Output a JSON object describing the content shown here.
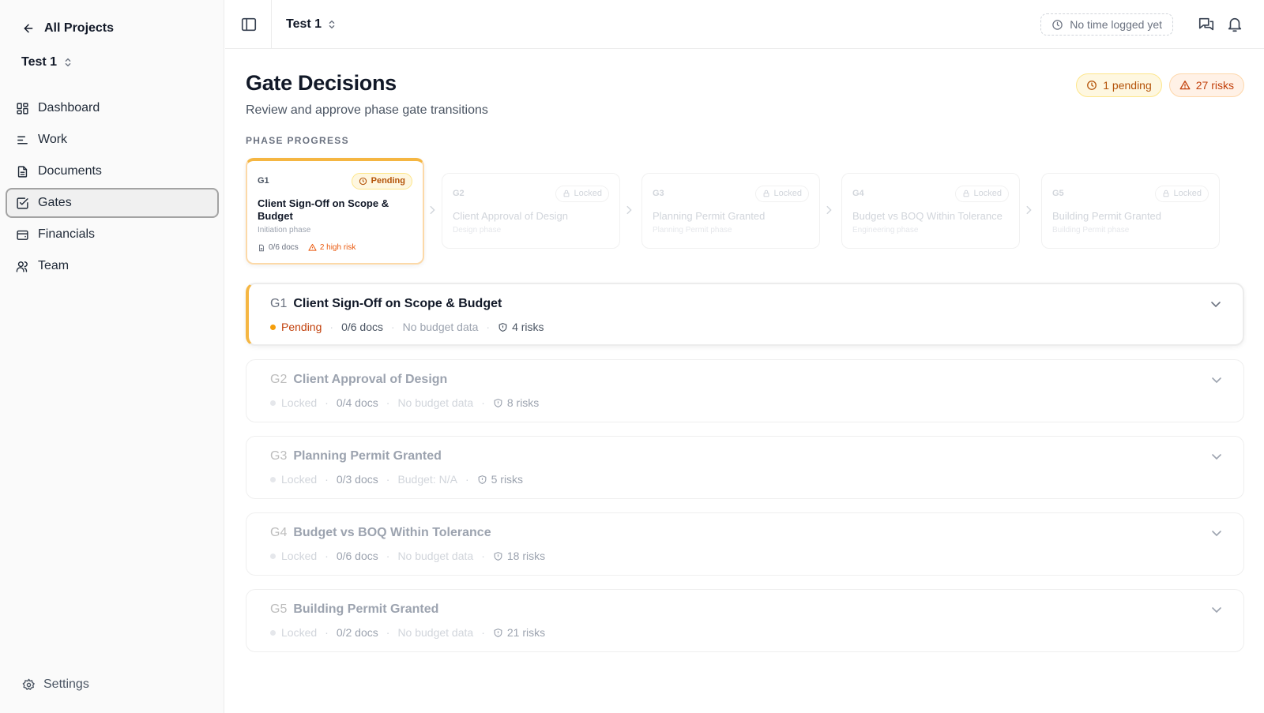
{
  "sidebar": {
    "back_label": "All Projects",
    "project_name": "Test 1",
    "nav": [
      {
        "label": "Dashboard",
        "icon": "dashboard-icon"
      },
      {
        "label": "Work",
        "icon": "work-icon"
      },
      {
        "label": "Documents",
        "icon": "document-icon"
      },
      {
        "label": "Gates",
        "icon": "gate-check-icon",
        "active": true
      },
      {
        "label": "Financials",
        "icon": "wallet-icon"
      },
      {
        "label": "Team",
        "icon": "team-icon"
      }
    ],
    "settings_label": "Settings"
  },
  "header": {
    "project_name": "Test 1",
    "time_logged": "No time logged yet"
  },
  "page": {
    "title": "Gate Decisions",
    "subtitle": "Review and approve phase gate transitions",
    "pending_badge": "1 pending",
    "risk_badge": "27 risks",
    "phase_progress_label": "PHASE PROGRESS"
  },
  "phases": [
    {
      "id": "G1",
      "status": "Pending",
      "title": "Client Sign-Off on Scope & Budget",
      "phase": "Initiation phase",
      "docs": "0/6 docs",
      "risk": "2 high risk"
    },
    {
      "id": "G2",
      "status": "Locked",
      "title": "Client Approval of Design",
      "phase": "Design phase"
    },
    {
      "id": "G3",
      "status": "Locked",
      "title": "Planning Permit Granted",
      "phase": "Planning Permit phase"
    },
    {
      "id": "G4",
      "status": "Locked",
      "title": "Budget vs BOQ Within Tolerance",
      "phase": "Engineering phase"
    },
    {
      "id": "G5",
      "status": "Locked",
      "title": "Building Permit Granted",
      "phase": "Building Permit phase"
    }
  ],
  "gates": [
    {
      "id": "G1",
      "name": "Client Sign-Off on Scope & Budget",
      "status": "Pending",
      "docs": "0/6 docs",
      "budget": "No budget data",
      "risks": "4 risks"
    },
    {
      "id": "G2",
      "name": "Client Approval of Design",
      "status": "Locked",
      "docs": "0/4 docs",
      "budget": "No budget data",
      "risks": "8 risks"
    },
    {
      "id": "G3",
      "name": "Planning Permit Granted",
      "status": "Locked",
      "docs": "0/3 docs",
      "budget": "Budget: N/A",
      "risks": "5 risks"
    },
    {
      "id": "G4",
      "name": "Budget vs BOQ Within Tolerance",
      "status": "Locked",
      "docs": "0/6 docs",
      "budget": "No budget data",
      "risks": "18 risks"
    },
    {
      "id": "G5",
      "name": "Building Permit Granted",
      "status": "Locked",
      "docs": "0/2 docs",
      "budget": "No budget data",
      "risks": "21 risks"
    }
  ],
  "colors": {
    "accent": "#f5b642",
    "pending_text": "#b45309",
    "risk_text": "#c2410c",
    "active_nav_border": "#a3a3a3"
  }
}
